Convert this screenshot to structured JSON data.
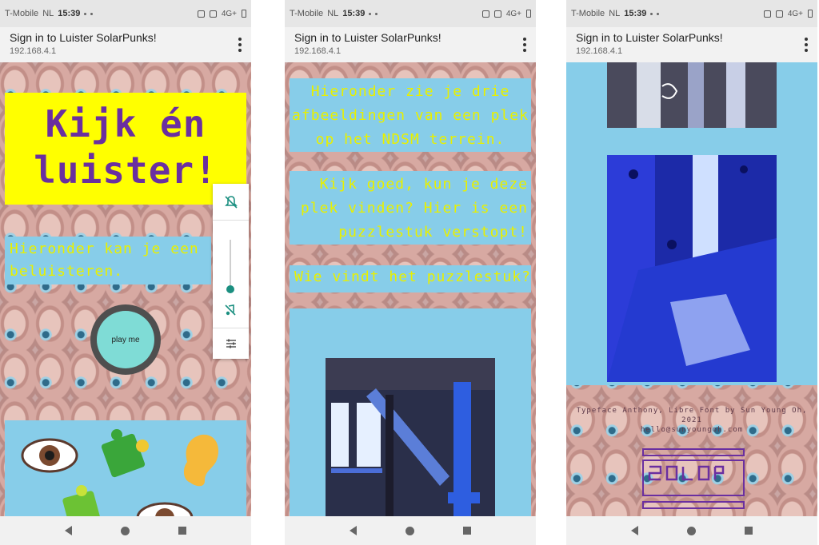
{
  "status": {
    "carrier": "T-Mobile",
    "region": "NL",
    "time": "15:39",
    "network": "4G+"
  },
  "browser": {
    "title": "Sign in to Luister SolarPunks!",
    "url": "192.168.4.1"
  },
  "screen1": {
    "headline": "Kijk én luister!",
    "instruction": "Hieronder kan je een beluisteren.",
    "play_label": "play me",
    "emojis": [
      "eye",
      "puzzle-piece",
      "ear",
      "puzzle-piece",
      "eye"
    ]
  },
  "screen2": {
    "text1": "Hieronder zie je drie afbeeldingen van een plek op het NDSM terrein.",
    "text2": "Kijk goed, kun je deze plek vinden? Hier is een puzzlestuk verstopt!",
    "text3": "Wie vindt het puzzlestuk?"
  },
  "screen3": {
    "credit_line1": "Typeface Anthony, Libre Font by Sun Young Oh, 2021",
    "credit_line2": "hello@sunyoungoh.com",
    "logo_text": "SolarPunk"
  },
  "colors": {
    "headline_bg": "#ffff00",
    "headline_text": "#6a2fa0",
    "panel_bg": "#87cde9",
    "panel_text": "#e8f000",
    "accent": "#1b8f80"
  }
}
